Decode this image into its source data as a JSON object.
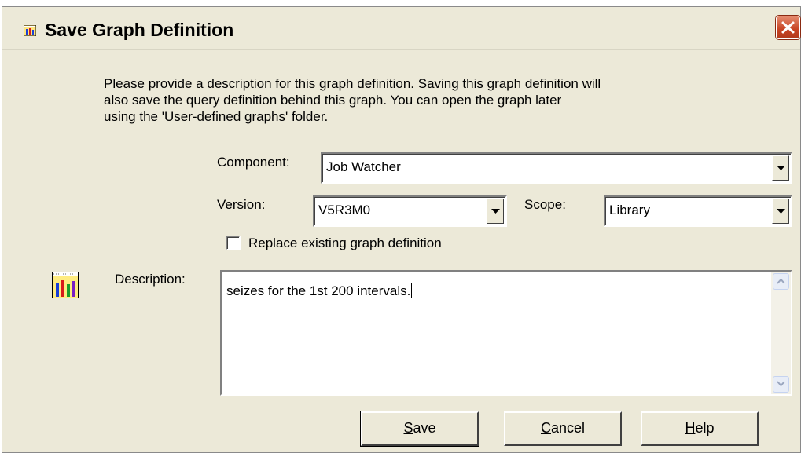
{
  "window": {
    "title": "Save Graph Definition",
    "title_icon": "bar-chart-icon",
    "close_icon": "close-icon"
  },
  "info": {
    "line1": "Please provide a description for this graph definition.  Saving this graph definition will",
    "line2": "also save the query definition behind this graph.  You can open the graph later",
    "line3": "using the 'User-defined graphs' folder."
  },
  "component": {
    "label": "Component:",
    "value": "Job Watcher"
  },
  "version": {
    "label": "Version:",
    "value": "V5R3M0"
  },
  "scope": {
    "label": "Scope:",
    "value": "Library"
  },
  "replace": {
    "label": "Replace existing graph definition",
    "checked": false
  },
  "description": {
    "label": "Description:",
    "value": "seizes for the 1st 200 intervals.",
    "icon": "graph-definition-icon"
  },
  "buttons": {
    "save": {
      "mnemonic": "S",
      "rest": "ave"
    },
    "cancel": {
      "mnemonic": "C",
      "rest": "ancel"
    },
    "help": {
      "mnemonic": "H",
      "rest": "elp"
    }
  },
  "colors": {
    "dialog_bg": "#ece9d8",
    "close_red": "#c74222"
  }
}
